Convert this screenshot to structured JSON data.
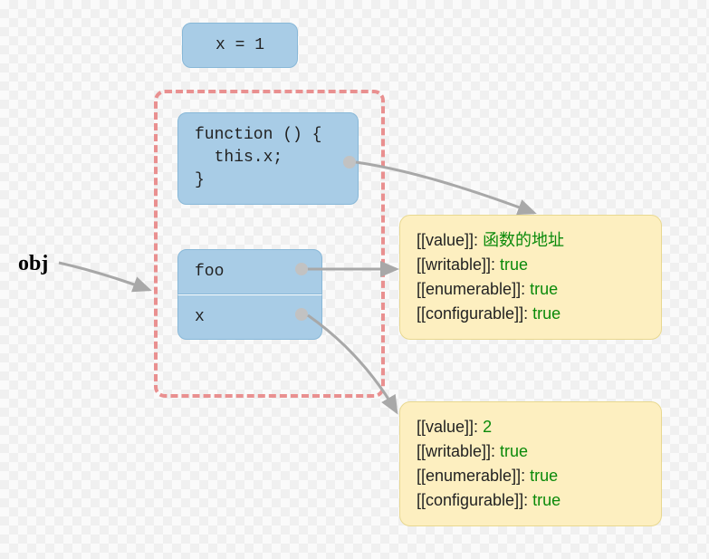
{
  "label": {
    "obj": "obj"
  },
  "boxes": {
    "assignment": "x = 1",
    "func_code": "function () {\n  this.x;\n}",
    "prop_foo": "foo",
    "prop_x": "x"
  },
  "descriptor_foo": {
    "value_key": "[[value]]:",
    "value_val": "函数的地址",
    "writable_key": "[[writable]]:",
    "writable_val": "true",
    "enumerable_key": "[[enumerable]]:",
    "enumerable_val": "true",
    "configurable_key": "[[configurable]]:",
    "configurable_val": "true"
  },
  "descriptor_x": {
    "value_key": "[[value]]:",
    "value_val": "2",
    "writable_key": "[[writable]]:",
    "writable_val": "true",
    "enumerable_key": "[[enumerable]]:",
    "enumerable_val": "true",
    "configurable_key": "[[configurable]]:",
    "configurable_val": "true"
  }
}
